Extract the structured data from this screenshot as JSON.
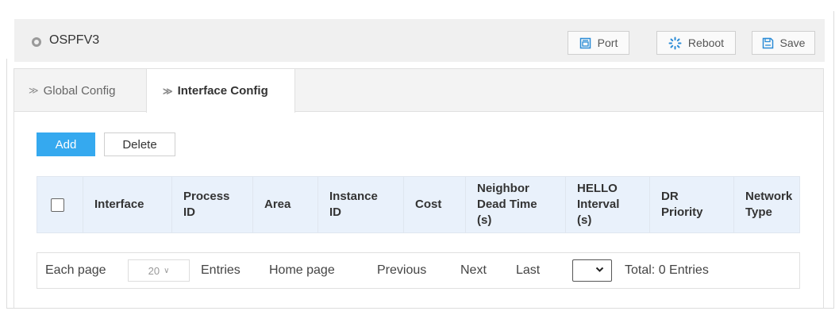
{
  "header": {
    "title": "OSPFV3",
    "title_icon": "location-pin-icon",
    "buttons": {
      "port": {
        "label": "Port",
        "icon": "port-icon"
      },
      "reboot": {
        "label": "Reboot",
        "icon": "reboot-icon"
      },
      "save": {
        "label": "Save",
        "icon": "save-icon"
      }
    }
  },
  "tabs": [
    {
      "label": "Global Config",
      "active": false
    },
    {
      "label": "Interface Config",
      "active": true
    }
  ],
  "actions": {
    "add_label": "Add",
    "delete_label": "Delete"
  },
  "table": {
    "columns": [
      "Interface",
      "Process ID",
      "Area",
      "Instance ID",
      "Cost",
      "Neighbor Dead Time (s)",
      "HELLO Interval (s)",
      "DR Priority",
      "Network Type"
    ],
    "rows": []
  },
  "pagination": {
    "each_page_label": "Each page",
    "page_size": "20",
    "entries_label": "Entries",
    "home_label": "Home page",
    "previous_label": "Previous",
    "next_label": "Next",
    "last_label": "Last",
    "total_text": "Total: 0 Entries"
  },
  "colors": {
    "accent": "#35a9ef",
    "icon_blue": "#2a8bd6",
    "header_bg": "#e9f1fb"
  }
}
